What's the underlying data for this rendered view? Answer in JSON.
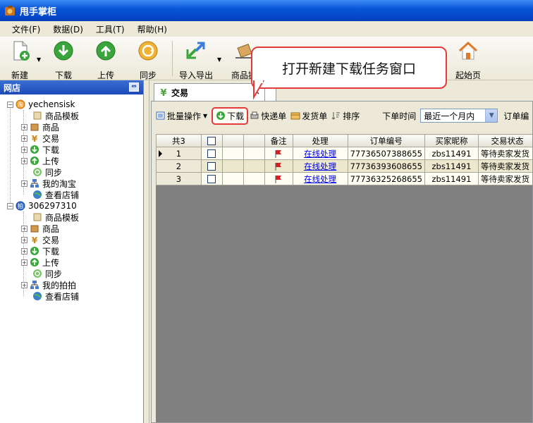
{
  "window": {
    "title": "甩手掌柜"
  },
  "menu": [
    "文件(F)",
    "数据(D)",
    "工具(T)",
    "帮助(H)"
  ],
  "toolbar": {
    "new": "新建",
    "download": "下载",
    "upload": "上传",
    "sync": "同步",
    "import_export": "导入导出",
    "goods": "商品搬",
    "home": "起始页"
  },
  "sidebar": {
    "header": "网店",
    "shops": [
      {
        "name": "yechensisk",
        "items": [
          "商品模板",
          "商品",
          "交易",
          "下载",
          "上传",
          "同步",
          "我的淘宝",
          "查看店铺"
        ]
      },
      {
        "name": "306297310",
        "items": [
          "商品模板",
          "商品",
          "交易",
          "下载",
          "上传",
          "同步",
          "我的拍拍",
          "查看店铺"
        ]
      }
    ]
  },
  "tab": {
    "label": "交易",
    "close": "×"
  },
  "subbar": {
    "batch": "批量操作",
    "download": "下载",
    "express": "快递单",
    "ship": "发货单",
    "sort": "排序",
    "order_time_label": "下单时间",
    "order_time_value": "最近一个月内",
    "order_no_label": "订单编"
  },
  "table": {
    "count_label": "共3",
    "headers": [
      "备注",
      "处理",
      "订单编号",
      "买家昵称",
      "交易状态"
    ],
    "rows": [
      {
        "index": "1",
        "action": "在线处理",
        "order": "77736507388655",
        "buyer": "zbs11491",
        "status": "等待卖家发货"
      },
      {
        "index": "2",
        "action": "在线处理",
        "order": "77736393608655",
        "buyer": "zbs11491",
        "status": "等待卖家发货"
      },
      {
        "index": "3",
        "action": "在线处理",
        "order": "77736325268655",
        "buyer": "zbs11491",
        "status": "等待卖家发货"
      }
    ]
  },
  "callout": {
    "text": "打开新建下载任务窗口"
  },
  "colors": {
    "callout_border": "#e53a3a",
    "titlebar": "#0a57d8",
    "flag": "#d42020"
  }
}
